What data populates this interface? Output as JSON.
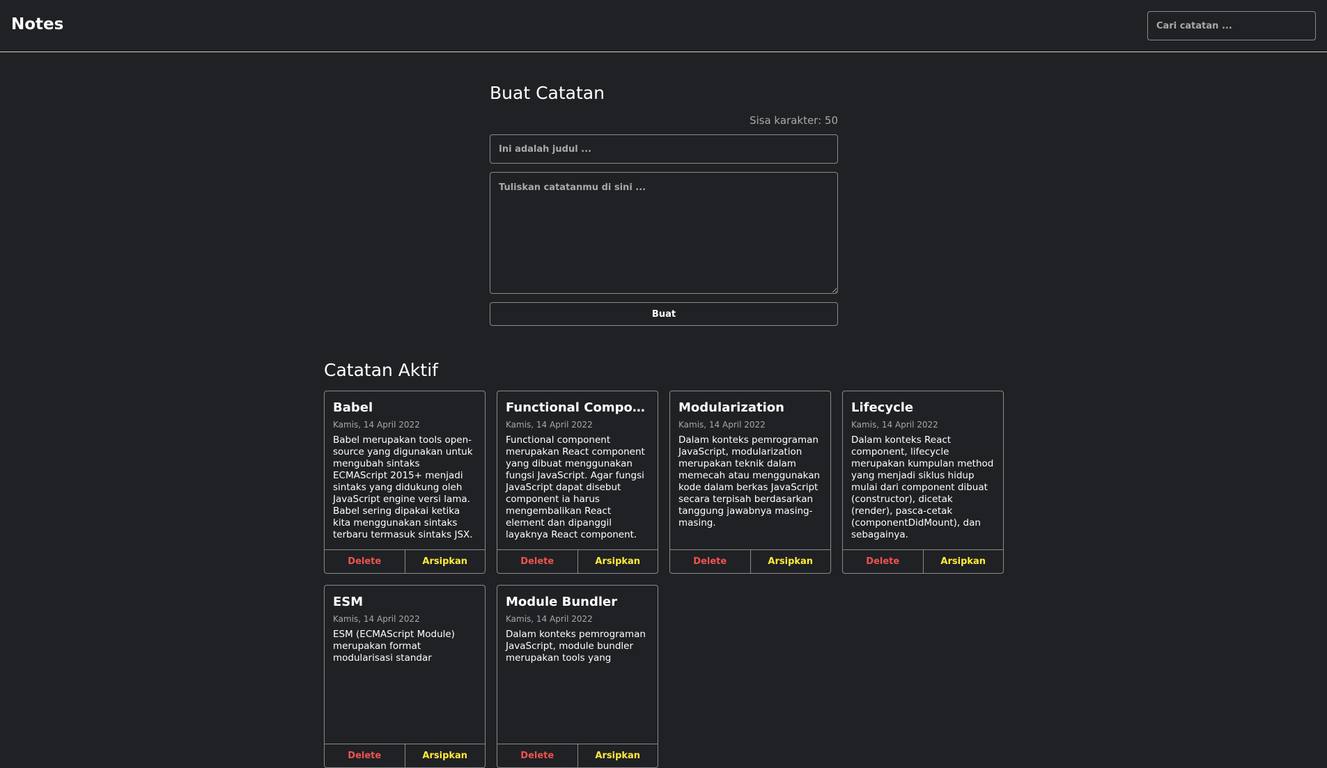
{
  "header": {
    "brand": "Notes",
    "search_placeholder": "Cari catatan ..."
  },
  "create": {
    "title": "Buat Catatan",
    "char_remaining": "Sisa karakter: 50",
    "title_placeholder": "Ini adalah judul ...",
    "body_placeholder": "Tuliskan catatanmu di sini ...",
    "submit_label": "Buat"
  },
  "active_notes": {
    "title": "Catatan Aktif",
    "delete_label": "Delete",
    "archive_label": "Arsipkan",
    "items": [
      {
        "title": "Babel",
        "date": "Kamis, 14 April 2022",
        "body": "Babel merupakan tools open-source yang digunakan untuk mengubah sintaks ECMAScript 2015+ menjadi sintaks yang didukung oleh JavaScript engine versi lama. Babel sering dipakai ketika kita menggunakan sintaks terbaru termasuk sintaks JSX."
      },
      {
        "title": "Functional Component",
        "date": "Kamis, 14 April 2022",
        "body": "Functional component merupakan React component yang dibuat menggunakan fungsi JavaScript. Agar fungsi JavaScript dapat disebut component ia harus mengembalikan React element dan dipanggil layaknya React component."
      },
      {
        "title": "Modularization",
        "date": "Kamis, 14 April 2022",
        "body": "Dalam konteks pemrograman JavaScript, modularization merupakan teknik dalam memecah atau menggunakan kode dalam berkas JavaScript secara terpisah berdasarkan tanggung jawabnya masing-masing."
      },
      {
        "title": "Lifecycle",
        "date": "Kamis, 14 April 2022",
        "body": "Dalam konteks React component, lifecycle merupakan kumpulan method yang menjadi siklus hidup mulai dari component dibuat (constructor), dicetak (render), pasca-cetak (componentDidMount), dan sebagainya."
      },
      {
        "title": "ESM",
        "date": "Kamis, 14 April 2022",
        "body": "ESM (ECMAScript Module) merupakan format modularisasi standar"
      },
      {
        "title": "Module Bundler",
        "date": "Kamis, 14 April 2022",
        "body": "Dalam konteks pemrograman JavaScript, module bundler merupakan tools yang"
      }
    ]
  }
}
